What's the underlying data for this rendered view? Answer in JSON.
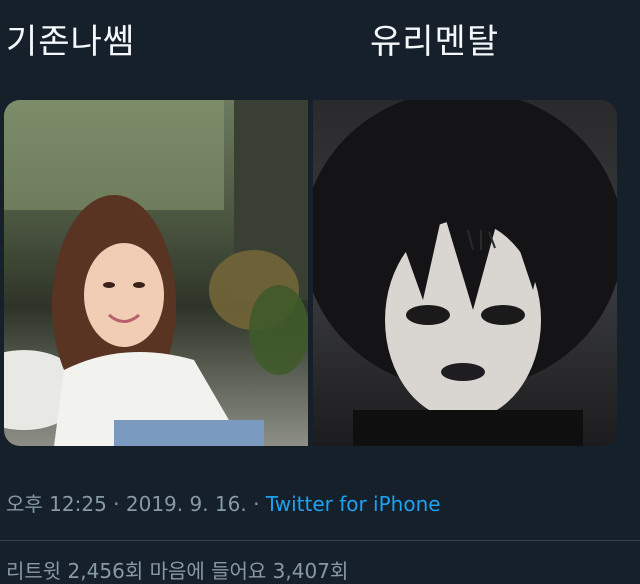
{
  "labels": {
    "left": "기존나쎔",
    "right": "유리멘탈"
  },
  "tweet_meta": {
    "time": "오후 12:25",
    "separator": "·",
    "date": "2019. 9. 16.",
    "source": "Twitter for iPhone"
  },
  "stats": {
    "text": "리트윗 2,456회  마음에 들어요 3,407회"
  },
  "colors": {
    "background": "#15202b",
    "muted_text": "#8899a6",
    "link": "#1da1f2"
  }
}
